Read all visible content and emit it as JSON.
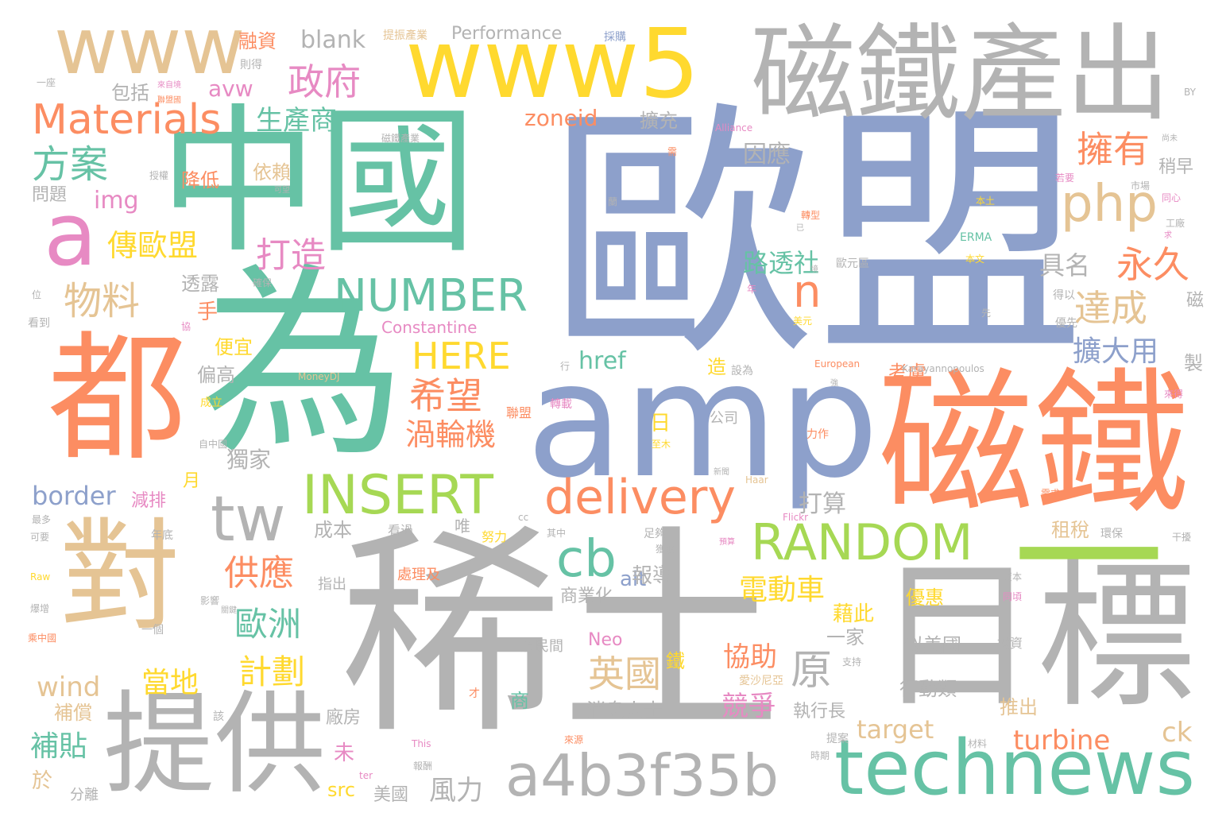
{
  "colors": {
    "green": "#66c2a5",
    "orange": "#fc8d62",
    "blue": "#8da0cb",
    "pink": "#e78ac3",
    "lime": "#a6d854",
    "yellow": "#ffd92f",
    "tan": "#e5c494",
    "grey": "#b3b3b3"
  },
  "words": {
    "w_oumeng": "歐盟",
    "w_xitu": "稀土",
    "w_wei": "為",
    "w_zhongguo": "中國",
    "w_amp": "amp",
    "w_citie": "磁鐵",
    "w_dui": "對",
    "w_dou": "都",
    "w_mubiao": "目標",
    "w_tigong": "提供",
    "w_citiechanchu": "磁鐵產出",
    "w_www5": "www5",
    "w_www": "www",
    "w_technews": "technews",
    "w_a4b3f35b": "a4b3f35b",
    "w_a": "a",
    "w_yi": "一",
    "w_tw": "tw",
    "w_insert": "INSERT",
    "w_random": "RANDOM",
    "w_delivery": "delivery",
    "w_number": "NUMBER",
    "w_php": "php",
    "w_materials": "Materials",
    "w_cb": "cb",
    "w_here": "HERE",
    "w_zhengfu": "政府",
    "w_fangan": "方案",
    "w_wuliao": "物料",
    "w_yongyou": "擁有",
    "w_yongjiu": "永久",
    "w_dacheng": "達成",
    "w_xiwang": "希望",
    "w_dazao": "打造",
    "w_yingguo": "英國",
    "w_ouzhou": "歐洲",
    "w_gongying": "供應",
    "w_jihua": "計劃",
    "w_shengchanshang": "生產商",
    "w_chuanoumeng": "傳歐盟",
    "w_wolunji": "渦輪機",
    "w_diandongche": "電動車",
    "w_yuan": "原",
    "w_kuodayong": "擴大用",
    "w_lutoushe": "路透社",
    "w_jingzheng": "競爭",
    "w_xiezhu": "協助",
    "w_dangdi": "當地",
    "w_butie": "補貼",
    "w_jumingx": "具名",
    "w_n": "n",
    "w_blank": "blank",
    "w_performance": "Performance",
    "w_avw": "avw",
    "w_zoneid": "zoneid",
    "w_img": "img",
    "w_href": "href",
    "w_border": "border",
    "w_wind": "wind",
    "w_target": "target",
    "w_turbine": "turbine",
    "w_ck": "ck",
    "w_src": "src",
    "w_alt": "alt",
    "w_neo": "Neo",
    "w_constantine": "Constantine",
    "w_fengli": "風力",
    "w_dusuan": "打算",
    "w_yinying": "因應",
    "w_kuochong": "擴充",
    "w_jiangdi": "降低",
    "w_yilai": "依賴",
    "w_wenti": "問題",
    "w_baokuo": "包括",
    "w_rongzi": "融資",
    "w_toulu": "透露",
    "w_shou": "手",
    "w_pianyi": "便宜",
    "w_piangao": "偏高",
    "w_dujia": "獨家",
    "w_jianpai": "減排",
    "w_yue": "月",
    "w_ri": "日",
    "w_kaolu": "考慮",
    "w_chengben": "成本",
    "w_baodao": "報導",
    "w_shangyehua": "商業化",
    "w_youhui": "優惠",
    "w_jieci": "藉此",
    "w_yijia": "一家",
    "w_simeiguo": "似美國",
    "w_xingdonglei": "行動類",
    "w_zhixingzhang": "執行長",
    "w_xiaoxirenshi": "消息人士",
    "w_tuichu": "推出",
    "w_zushui": "租稅",
    "w_shaozao": "稍早",
    "w_zhi": "製",
    "w_ci": "磁",
    "w_buchang": "補償",
    "w_yu": "於",
    "w_wei2": "未",
    "w_meiguo": "美國",
    "w_changfang": "廠房",
    "w_zao": "造",
    "w_tie": "鐵",
    "w_shang": "商",
    "w_fenli": "分離",
    "w_gongsi": "公司",
    "w_shebei": "設為",
    "w_lianmeng": "聯盟",
    "w_zhuanzai": "轉載",
    "w_chengli": "成立",
    "w_zizhongguo": "自中國",
    "w_nuli": "努力",
    "w_kanguo": "看過",
    "w_wei3": "唯",
    "w_zhichu": "指出",
    "w_chulijiji": "處理及",
    "w_jiminjian": "及民間",
    "w_zhichi": "支持",
    "w_aishaniya": "愛沙尼亞",
    "w_cai": "才",
    "w_cailiao": "材料",
    "w_zijin": "資本",
    "w_touzi": "投資",
    "w_tongqi": "同頃",
    "w_xuqiu": "需求",
    "w_huanbao": "環保",
    "w_ganrao": "干擾",
    "w_gongchang": "工廠",
    "w_shichang": "市場",
    "w_tongxin": "同心",
    "w_benti": "本土",
    "w_erma": "ERMA",
    "w_benwen": "本文",
    "w_deyi": "得以",
    "w_youxian": "優先",
    "w_xian": "先",
    "w_zhuanxing": "轉型",
    "w_ouyuanqu": "歐元區",
    "w_meiyuan": "美元",
    "w_european": "European",
    "w_karayannopoulos": "Karayannopoulos",
    "w_moneydj": "MoneyDJ",
    "w_alliance": "Alliance",
    "w_haar": "Haar",
    "w_flickr": "Flickr",
    "w_cc": "cc",
    "w_raw": "Raw",
    "w_this": "This",
    "w_ter": "ter",
    "w_by": "BY",
    "w_tizhenchanye": "提振產業",
    "w_cicaichanye": "磁鐵產業",
    "w_caigou": "採購",
    "w_zede": "則得",
    "w_yizuo": "一座",
    "w_laizijing": "來自境",
    "w_shouquan": "授權",
    "w_kezhi": "可望",
    "w_kexing": "可能",
    "w_baoxian": "確保",
    "w_wei4": "位",
    "w_kandao": "看到",
    "w_xie": "協",
    "w_yeru": "若",
    "w_zuiduo": "最多",
    "w_keyao": "可要",
    "w_baozeng": "爆增",
    "w_tuozhongguo": "乘中國",
    "w_nianju": "年底",
    "w_yingxiang": "影響",
    "w_guanjian": "關鍵",
    "w_yige": "一個",
    "w_gai": "該",
    "w_tiaoan": "提案",
    "w_baochou": "報酬",
    "w_shichuang": "時期",
    "w_diaoyan": "調查",
    "w_laiyuan": "來源",
    "w_lizuo": "力作",
    "w_xinwen": "新聞",
    "w_yuchi": "預算",
    "w_zujia": "足夠",
    "w_huoqu": "獲取",
    "w_qizhong": "其中",
    "w_tongnian": "年",
    "w_xin": "行",
    "w_qiang": "強",
    "w_zhimu": "至木",
    "w_jingduan": "境",
    "w_shi": "已",
    "w_fanggan": "蘭",
    "w_zhuanpai": "需",
    "w_ruoyao": "若要",
    "w_shiyong": "尚未",
    "w_laiyou": "求",
    "w_lianbang": "聯盟國",
    "w_kuaijie": "來得"
  }
}
